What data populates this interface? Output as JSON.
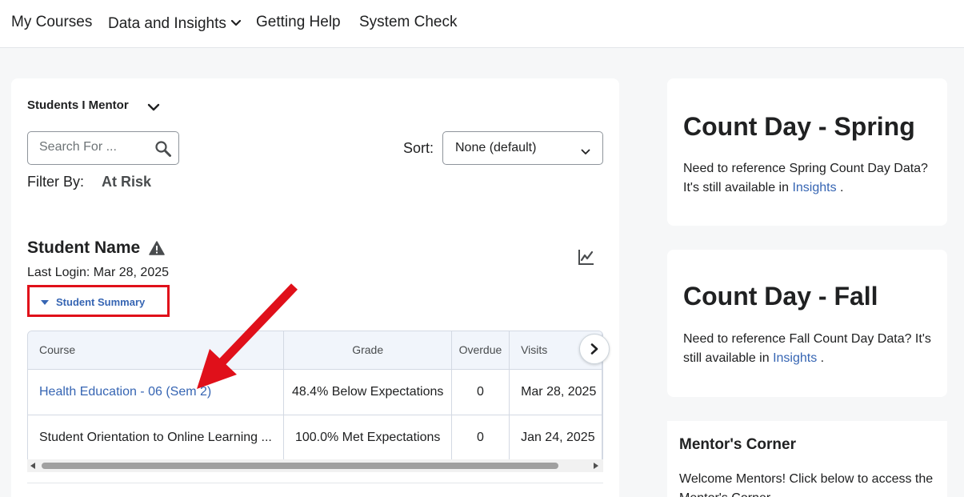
{
  "nav": {
    "items": [
      {
        "label": "My Courses"
      },
      {
        "label": "Data and Insights"
      },
      {
        "label": "Getting Help"
      },
      {
        "label": "System Check"
      }
    ]
  },
  "mentor_widget": {
    "title": "Students I Mentor",
    "search": {
      "placeholder": "Search For ...",
      "value": ""
    },
    "sort": {
      "label": "Sort:",
      "selected": "None (default)"
    },
    "filter": {
      "label": "Filter By:",
      "value": "At Risk"
    },
    "student": {
      "name": "Student Name",
      "last_login": "Last Login: Mar 28, 2025",
      "summary_toggle": "Student Summary"
    },
    "table": {
      "columns": [
        "Course",
        "Grade",
        "Overdue",
        "Visits"
      ],
      "rows": [
        {
          "course": "Health Education - 06 (Sem 2)",
          "grade": "48.4% Below Expectations",
          "overdue": "0",
          "visits": "Mar 28, 2025"
        },
        {
          "course": "Student Orientation to Online Learning ...",
          "grade": "100.0% Met Expectations",
          "overdue": "0",
          "visits": "Jan 24, 2025"
        }
      ]
    }
  },
  "spring_card": {
    "title": "Count Day - Spring",
    "text": "Need to reference Spring Count Day Data? It's still available in",
    "link": "Insights",
    "suffix": " ."
  },
  "fall_card": {
    "title": "Count Day - Fall",
    "text": "Need to reference Fall Count Day Data? It's still available in",
    "link": "Insights",
    "suffix": " ."
  },
  "mentor_corner": {
    "title": "Mentor's Corner",
    "text": "Welcome Mentors! Click below to access the Mentor's Corner."
  },
  "colors": {
    "link": "#3665b3",
    "annotation": "#e0101a",
    "page_bg": "#f6f7f8"
  },
  "icons": [
    "chevron-down-icon",
    "search-icon",
    "warning-icon",
    "chart-icon",
    "chevron-right-icon",
    "triangle-down-icon"
  ]
}
